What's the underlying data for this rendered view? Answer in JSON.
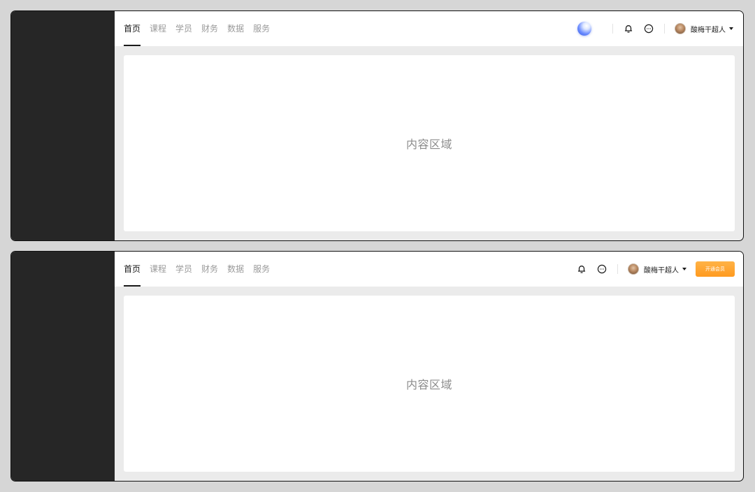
{
  "layouts": [
    {
      "nav": [
        "首页",
        "课程",
        "学员",
        "财务",
        "数据",
        "服务"
      ],
      "active_nav": 0,
      "user_name": "酸梅干超人",
      "content_placeholder": "内容区域",
      "icons": [
        "assistant-orb-icon",
        "bell-icon",
        "message-icon",
        "avatar",
        "chevron-down-icon"
      ]
    },
    {
      "nav": [
        "首页",
        "课程",
        "学员",
        "财务",
        "数据",
        "服务"
      ],
      "active_nav": 0,
      "user_name": "酸梅干超人",
      "vip_button": "开通会员",
      "content_placeholder": "内容区域",
      "icons": [
        "bell-icon",
        "message-icon",
        "avatar",
        "chevron-down-icon"
      ]
    }
  ],
  "colors": {
    "sidebar": "#262626",
    "active_text": "#1a1a1a",
    "inactive_text": "#9a9a9a",
    "vip_gradient": [
      "#ffb347",
      "#ff9a1f"
    ]
  }
}
